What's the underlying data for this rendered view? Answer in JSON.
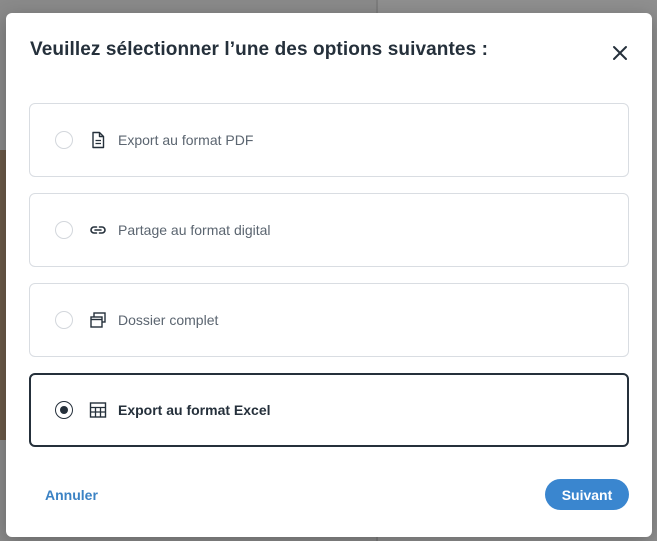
{
  "modal": {
    "title": "Veuillez sélectionner l’une des options suivantes :",
    "close_icon": "close-icon",
    "options": [
      {
        "label": "Export au format PDF",
        "icon": "document-icon",
        "selected": false
      },
      {
        "label": "Partage au format digital",
        "icon": "link-icon",
        "selected": false
      },
      {
        "label": "Dossier complet",
        "icon": "windows-icon",
        "selected": false
      },
      {
        "label": "Export au format Excel",
        "icon": "table-icon",
        "selected": true
      }
    ],
    "cancel_label": "Annuler",
    "next_label": "Suivant"
  },
  "colors": {
    "primary": "#3a86cf",
    "text_dark": "#25303b",
    "text_muted": "#5b6570",
    "border": "#d9dde2"
  }
}
